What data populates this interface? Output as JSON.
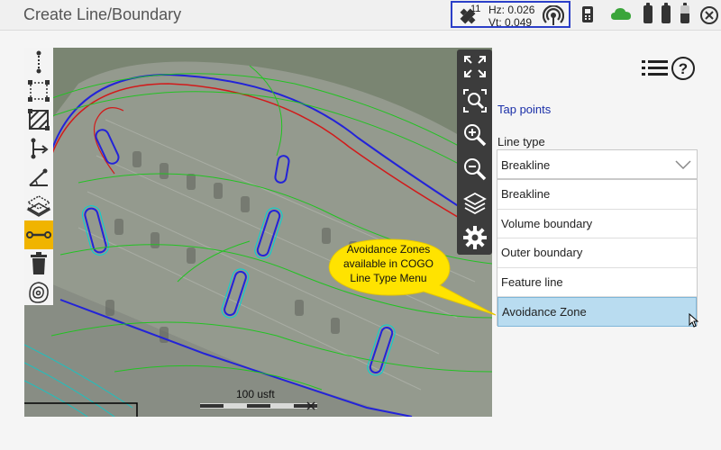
{
  "window": {
    "title": "Create Line/Boundary"
  },
  "gnss": {
    "satellites": "11",
    "hz": "Hz: 0.026",
    "vt": "Vt: 0.049"
  },
  "map": {
    "scale_label": "100 usft"
  },
  "callout": {
    "lines": [
      "Avoidance Zones",
      "available in COGO",
      "Line Type Menu"
    ]
  },
  "panel": {
    "tap_points": "Tap points",
    "line_type_label": "Line type",
    "line_type_value": "Breakline",
    "options": [
      "Breakline",
      "Volume boundary",
      "Outer boundary",
      "Feature line",
      "Avoidance Zone"
    ],
    "selected_option": "Avoidance Zone"
  },
  "icons": {
    "top": [
      "satellite-icon",
      "radio-icon",
      "controller-icon",
      "cloud-icon",
      "battery-icon",
      "battery-icon",
      "battery-icon",
      "close-icon"
    ],
    "left_tools": [
      "line-vertical-icon",
      "boundary-icon",
      "hatched-area-icon",
      "branch-line-icon",
      "angle-line-icon",
      "surface-layer-icon",
      "avoidance-line-icon",
      "trash-icon",
      "contour-icon"
    ],
    "right_tools": [
      "fullscreen-icon",
      "zoom-extent-icon",
      "zoom-in-icon",
      "zoom-out-icon",
      "layers-icon",
      "settings-icon"
    ],
    "panel": [
      "menu-list-icon",
      "help-icon"
    ]
  },
  "colors": {
    "accent_blue": "#1a2fa8",
    "active_tool": "#f0b400",
    "selected_row": "#b9dcf0",
    "callout": "#ffe300",
    "cloud": "#3aa53a"
  }
}
